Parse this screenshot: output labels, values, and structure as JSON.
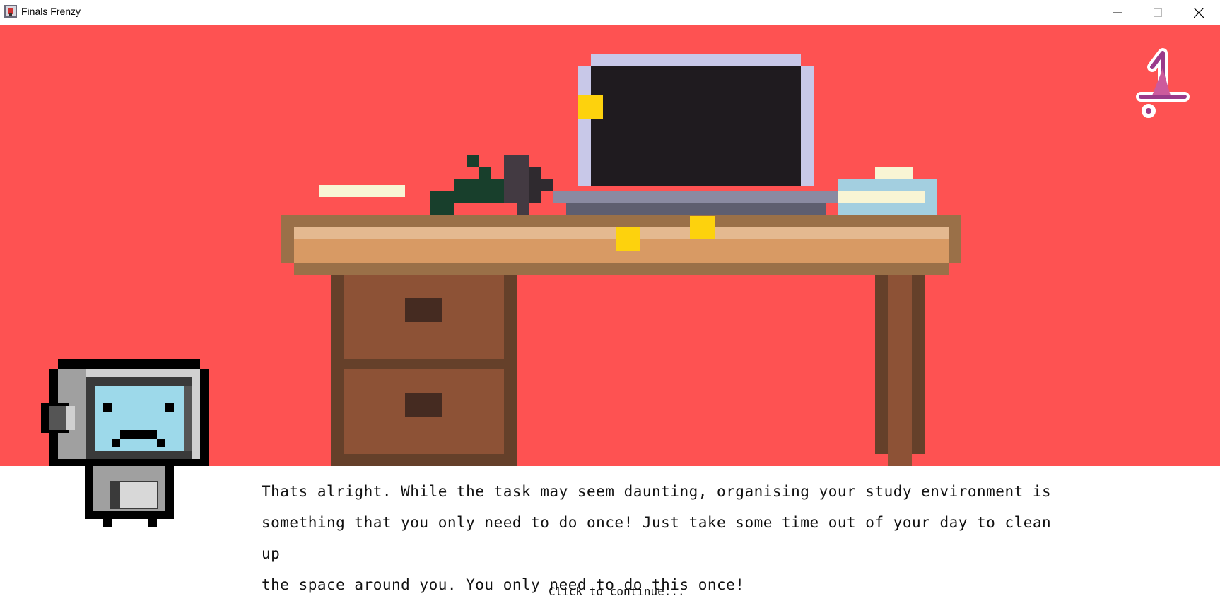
{
  "window": {
    "title": "Finals Frenzy",
    "controls": [
      "minimize",
      "maximize",
      "close"
    ]
  },
  "hud": {
    "level_number": "1"
  },
  "dialog": {
    "lines": [
      "Thats alright. While the task may seem daunting, organising your study environment is",
      "something that you only need to do once! Just take some time out of your day to clean up",
      "the space around you. You only need to do this once!"
    ],
    "continue_prompt": "Click to continue..."
  },
  "colors": {
    "background": "#fe5252",
    "desk_top": "#d89a64",
    "desk_edge": "#9a7048",
    "drawer": "#8d5236",
    "laptop_frame": "#c8c8e8",
    "laptop_screen": "#1f1b1f",
    "robot_screen": "#9dd9ea",
    "sticky_note": "#fdd20d",
    "level_badge": "#9a3a8a"
  }
}
